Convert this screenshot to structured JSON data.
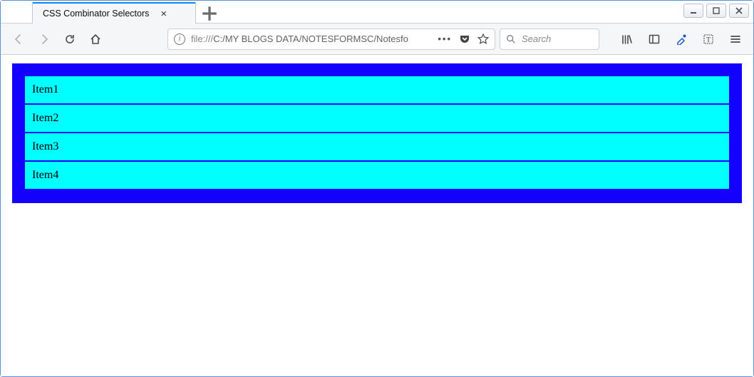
{
  "window": {
    "tab_title": "CSS Combinator Selectors"
  },
  "toolbar": {
    "url_protocol": "file:///",
    "url_path": "C:/MY BLOGS DATA/NOTESFORMSC/Notesfo",
    "search_placeholder": "Search"
  },
  "content": {
    "items": [
      "Item1",
      "Item2",
      "Item3",
      "Item4"
    ]
  }
}
